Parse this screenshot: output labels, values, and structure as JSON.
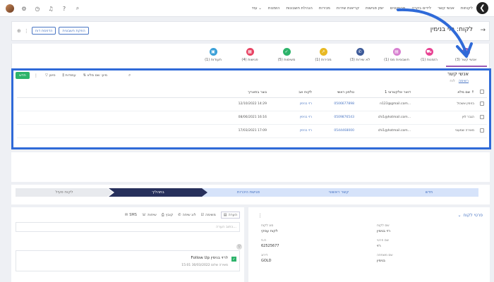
{
  "nav": {
    "items": [
      "לקוחות",
      "אנשי קשר",
      "לידים בקרה",
      "פרויקטים",
      "יומן פגישות",
      "קריאות שירות",
      "מכירות",
      "הנהלת חשבונות",
      "הזמנות",
      "עוד"
    ],
    "logo_glyph": "❮"
  },
  "header": {
    "title": "לקוח: רזי בנימין",
    "btn_print": "הדפסת דוח",
    "btn_note": "הפקת חשבונית"
  },
  "tabs": [
    {
      "label": "אנשי קשר (3)",
      "color": "#9b59b6"
    },
    {
      "label": "הזמנות (1)",
      "color": "#e84393"
    },
    {
      "label": "חשבוניות מס (1)",
      "color": "#d77fd0"
    },
    {
      "label": "לא שירות (3)",
      "color": "#3d5a99"
    },
    {
      "label": "מכירות (1)",
      "color": "#e8b923"
    },
    {
      "label": "משימות (5)",
      "color": "#2db36a"
    },
    {
      "label": "פגישות (4)",
      "color": "#e84363"
    },
    {
      "label": "תעודות (1)",
      "color": "#3aa0d8"
    }
  ],
  "contacts": {
    "title": "אנשי קשר",
    "sub_list": "רשימה",
    "sub_other": "לוח",
    "new_label": "חדש",
    "toolbar": {
      "filter": "סינון",
      "columns": "עמודות",
      "sort": "מיון: שם מלא"
    },
    "columns": [
      "שם מלא",
      "דואר אלקטרוני 1",
      "טלפון ראשי",
      "לקוח אב",
      "נוצר בתאריך"
    ],
    "rows": [
      {
        "name": "בנימין אשכול",
        "email": "...n123@gmail.com",
        "phone": "0506677898",
        "parent": "רזי בנימין",
        "created": "14:29 12/10/2022"
      },
      {
        "name": "הגבר לוין",
        "email": "...chi1@hotmail.com",
        "phone": "0509876543",
        "parent": "רזי בנימין",
        "created": "16:16 08/06/2021"
      },
      {
        "name": "מאירה שמעוני",
        "email": "...chi1@hotmail.com",
        "phone": "0544468000",
        "parent": "רזי בנימין",
        "created": "17:09 17/03/2021"
      }
    ]
  },
  "pipeline": {
    "stages": [
      "חדש",
      "קשר ראשוני",
      "פגישת היכרות",
      "בתהליך",
      "לקוח פעיל"
    ],
    "active_index": 3
  },
  "activity": {
    "actions": [
      "הערה",
      "משימה",
      "לוג שיחה",
      "קובץ",
      "SMS",
      "שיחות"
    ],
    "placeholder": "כתוב הערה...",
    "item_title": "Follow Up לרזי בנימין",
    "item_meta": "מאירה שלום  30/03/2022 15:01"
  },
  "details": {
    "title": "פרטי לקוח",
    "fields": [
      {
        "label": "שם לקוח",
        "value": "רזי בנימין"
      },
      {
        "label": "סוג לקוח",
        "value": "לקוח עסקי"
      },
      {
        "label": "שם פרטי",
        "value": "רזי"
      },
      {
        "label": "ח.פ",
        "value": "62525677"
      },
      {
        "label": "שם משפחה",
        "value": "בנימין"
      },
      {
        "label": "דירוג",
        "value": "GOLD"
      }
    ]
  }
}
